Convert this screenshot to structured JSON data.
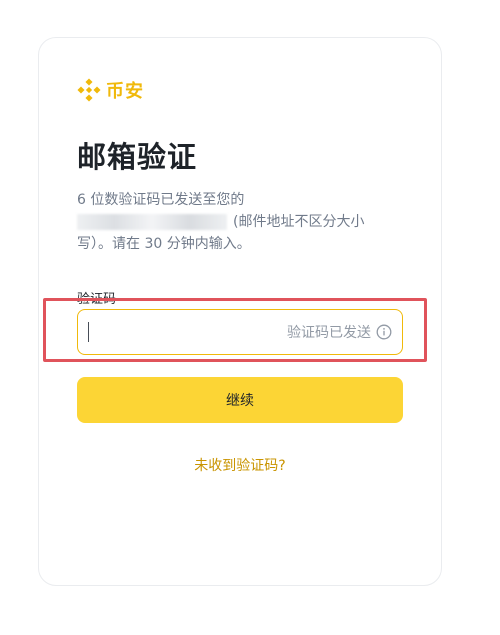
{
  "brand": {
    "name": "币安",
    "logo_icon": "binance-diamond-logo",
    "accent_color": "#f0b90b"
  },
  "page": {
    "title": "邮箱验证",
    "desc_line1": "6 位数验证码已发送至您的",
    "desc_line2_suffix": "(邮件地址不区分大小",
    "desc_line3": "写）。请在 30 分钟内输入。"
  },
  "form": {
    "label": "验证码",
    "input_value": "",
    "sent_text": "验证码已发送",
    "info_icon": "info-circle-icon",
    "submit_label": "继续"
  },
  "links": {
    "not_received": "未收到验证码?"
  },
  "colors": {
    "button_bg": "#fcd535",
    "link": "#c99400",
    "highlight_border": "#e0535b"
  }
}
